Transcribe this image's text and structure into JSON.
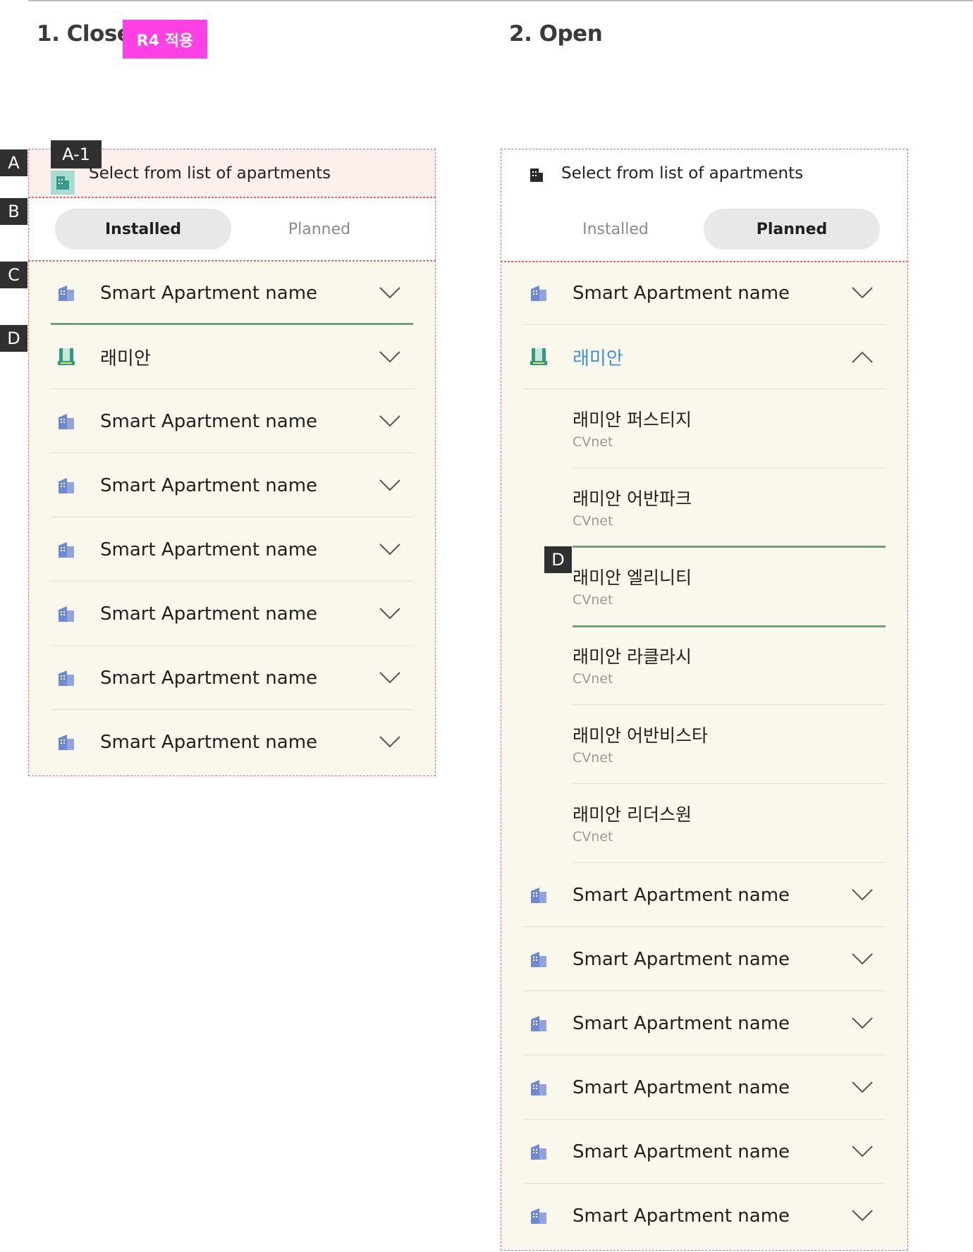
{
  "sections": {
    "close": {
      "title": "1. Close",
      "badge": "R4 적용"
    },
    "open": {
      "title": "2. Open"
    }
  },
  "markers": {
    "a": "A",
    "a1": "A-1",
    "b": "B",
    "c": "C",
    "d": "D"
  },
  "header": {
    "label": "Select from list of apartments",
    "icon": "building-icon"
  },
  "tabs": {
    "installed": "Installed",
    "planned": "Planned"
  },
  "close_panel": {
    "active_tab": "Installed",
    "items": [
      {
        "name": "Smart Apartment name",
        "icon": "building-icon"
      },
      {
        "name": "래미안",
        "icon": "raemian-logo-icon"
      },
      {
        "name": "Smart Apartment name",
        "icon": "building-icon"
      },
      {
        "name": "Smart Apartment name",
        "icon": "building-icon"
      },
      {
        "name": "Smart Apartment name",
        "icon": "building-icon"
      },
      {
        "name": "Smart Apartment name",
        "icon": "building-icon"
      },
      {
        "name": "Smart Apartment name",
        "icon": "building-icon"
      },
      {
        "name": "Smart Apartment name",
        "icon": "building-icon"
      }
    ]
  },
  "open_panel": {
    "active_tab": "Planned",
    "items_before": [
      {
        "name": "Smart Apartment name",
        "icon": "building-icon"
      }
    ],
    "expanded": {
      "name": "래미안",
      "icon": "raemian-logo-icon",
      "children": [
        {
          "name": "래미안 퍼스티지",
          "vendor": "CVnet"
        },
        {
          "name": "래미안 어반파크",
          "vendor": "CVnet"
        },
        {
          "name": "래미안 엘리니티",
          "vendor": "CVnet"
        },
        {
          "name": "래미안 라클라시",
          "vendor": "CVnet"
        },
        {
          "name": "래미안 어반비스타",
          "vendor": "CVnet"
        },
        {
          "name": "래미안 리더스원",
          "vendor": "CVnet"
        }
      ]
    },
    "items_after": [
      {
        "name": "Smart Apartment name",
        "icon": "building-icon"
      },
      {
        "name": "Smart Apartment name",
        "icon": "building-icon"
      },
      {
        "name": "Smart Apartment name",
        "icon": "building-icon"
      },
      {
        "name": "Smart Apartment name",
        "icon": "building-icon"
      },
      {
        "name": "Smart Apartment name",
        "icon": "building-icon"
      },
      {
        "name": "Smart Apartment name",
        "icon": "building-icon"
      }
    ]
  },
  "colors": {
    "list_bg": "#faf8ed",
    "header_highlight": "#fdefec",
    "active_tab_bg": "#e8e8e8",
    "selected_line": "#6f9f7c",
    "building_icon": "#6e88d6",
    "expanded_text": "#3e8ed8",
    "badge": "#ff40e5",
    "marker": "#303030",
    "annotation_border": "#ea6a6a"
  }
}
